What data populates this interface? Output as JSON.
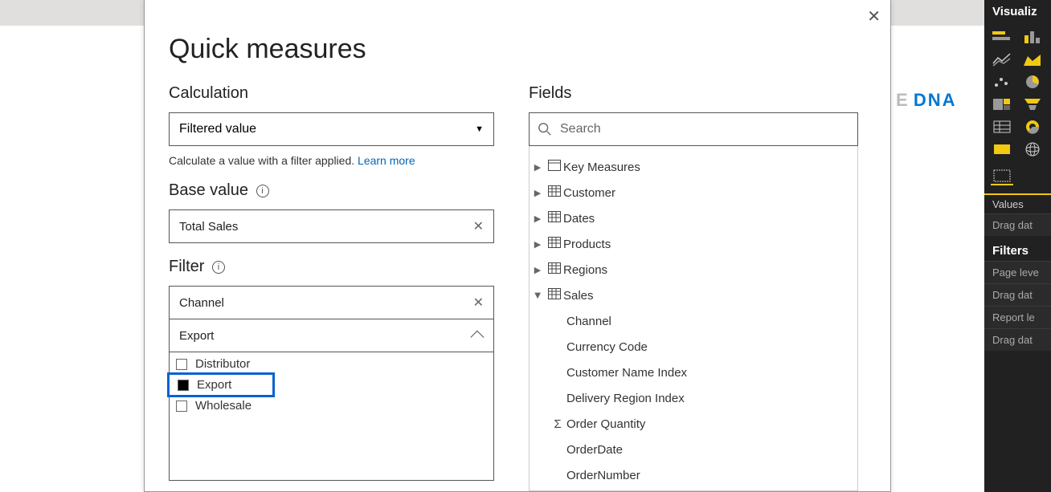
{
  "logo": {
    "prefix": "E",
    "suffix": "DNA"
  },
  "dialog": {
    "title": "Quick measures",
    "close_glyph": "✕",
    "calculation": {
      "label": "Calculation",
      "value": "Filtered value",
      "description": "Calculate a value with a filter applied.  ",
      "learn_more": "Learn more"
    },
    "base_value": {
      "label": "Base value",
      "value": "Total Sales"
    },
    "filter": {
      "label": "Filter",
      "value": "Channel",
      "selected_option": "Export",
      "options": [
        {
          "label": "Distributor",
          "checked": false
        },
        {
          "label": "Export",
          "checked": true
        },
        {
          "label": "Wholesale",
          "checked": false
        }
      ]
    },
    "fields": {
      "label": "Fields",
      "search_placeholder": "Search",
      "tables": [
        {
          "name": "Key Measures",
          "icon": "measure",
          "expanded": false
        },
        {
          "name": "Customer",
          "icon": "table",
          "expanded": false
        },
        {
          "name": "Dates",
          "icon": "table",
          "expanded": false
        },
        {
          "name": "Products",
          "icon": "table",
          "expanded": false
        },
        {
          "name": "Regions",
          "icon": "table",
          "expanded": false
        },
        {
          "name": "Sales",
          "icon": "table",
          "expanded": true,
          "columns": [
            {
              "name": "Channel",
              "sigma": false
            },
            {
              "name": "Currency Code",
              "sigma": false
            },
            {
              "name": "Customer Name Index",
              "sigma": false
            },
            {
              "name": "Delivery Region Index",
              "sigma": false
            },
            {
              "name": "Order Quantity",
              "sigma": true
            },
            {
              "name": "OrderDate",
              "sigma": false
            },
            {
              "name": "OrderNumber",
              "sigma": false
            }
          ]
        }
      ]
    }
  },
  "viz": {
    "title": "Visualiz",
    "values_label": "Values",
    "drag_hint": "Drag dat",
    "filters_label": "Filters",
    "page_level": "Page leve",
    "report_level": "Report le"
  }
}
